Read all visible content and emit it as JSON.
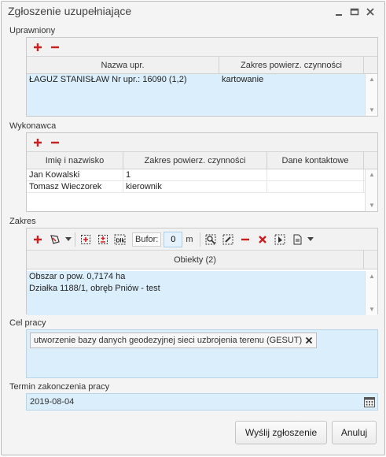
{
  "window": {
    "title": "Zgłoszenie uzupełniające"
  },
  "uprawniony": {
    "label": "Uprawniony",
    "columns": [
      "Nazwa upr.",
      "Zakres powierz. czynności"
    ],
    "rows": [
      {
        "name": "ŁAGUZ STANISŁAW Nr upr.: 16090 (1,2)",
        "scope": "kartowanie"
      }
    ]
  },
  "wykonawca": {
    "label": "Wykonawca",
    "columns": [
      "Imię i nazwisko",
      "Zakres powierz. czynności",
      "Dane kontaktowe"
    ],
    "rows": [
      {
        "name": "Jan Kowalski",
        "scope": "1",
        "contact": ""
      },
      {
        "name": "Tomasz Wieczorek",
        "scope": "kierownik",
        "contact": ""
      }
    ]
  },
  "zakres": {
    "label": "Zakres",
    "bufor_label": "Bufor:",
    "bufor_value": "0",
    "bufor_unit": "m",
    "objects_header": "Obiekty (2)",
    "objects": [
      "Obszar o pow. 0,7174 ha",
      "Działka 1188/1, obręb Pniów - test"
    ]
  },
  "cel_pracy": {
    "label": "Cel pracy",
    "tag": "utworzenie bazy danych geodezyjnej sieci uzbrojenia terenu (GESUT)"
  },
  "termin": {
    "label": "Termin zakonczenia pracy",
    "value": "2019-08-04"
  },
  "buttons": {
    "submit": "Wyślij zgłoszenie",
    "cancel": "Anuluj"
  },
  "colors": {
    "accent_red": "#cc1f1f",
    "selection_blue": "#dbeefb"
  }
}
